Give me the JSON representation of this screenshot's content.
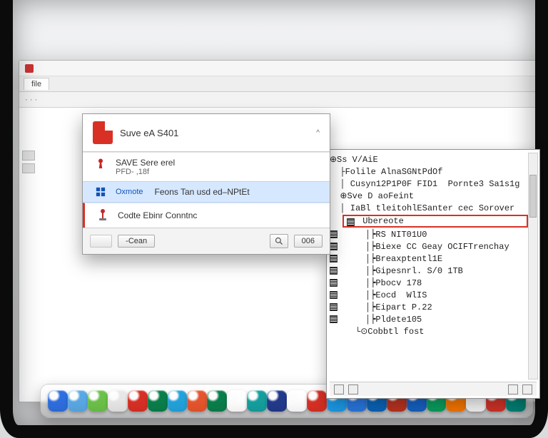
{
  "appwin": {
    "tab1": "file",
    "toolbar_hint": "· · ·"
  },
  "save_dialog": {
    "title": "Suve eA S401",
    "caret": "^",
    "r1_label": "SAVE Sere erel",
    "r1_sub": "PFD- ,18f",
    "sel_prefix": "Oxmote",
    "sel_text": "Feons Tan usd ed–NPtEt",
    "r3_text": "Codte Ebinr Conntnc",
    "cancel": "-Cean",
    "ok": "006"
  },
  "tree": {
    "l0": "⊕Ss V/AiE",
    "l1": "  ├Folile AlnaSGNtPdOf",
    "l2": "  │ Cusyn12P1P0F FID1  Pornte3 Sa1s1g",
    "l3": "  ⊕Sve D aoFeint",
    "l4": "  │ IaBl tleitohlESanter cec Sorover",
    "hl_text": "Ubereote",
    "l6": "     │┝RS NIT01U0",
    "l7": "     │┝Biexe CC Geay OCIFTrenchay",
    "l8": "     │┝Breaxptentl1E",
    "l9": "     │┝Gipesnrl. S/0 1TB",
    "l10": "     │┝Pbocv 178",
    "l11": "     │┝Eocd  WlIS",
    "l12": "     │┝Eipart P.22",
    "l13": "     │┝Pldete105",
    "l14": "     └⊙Cobbtl fost"
  },
  "dock_colors": [
    "#2f6fe0",
    "#5aa9e6",
    "#6cc24a",
    "#e8e8e8",
    "#d93025",
    "#0a7f4b",
    "#23a3dd",
    "#e8552d",
    "#0a7f4b",
    "#ffffff",
    "#15a0a0",
    "#233a8c",
    "#ffffff",
    "#d93025",
    "#1da1f2",
    "#2b7de9",
    "#0b68c1",
    "#c23522",
    "#1765cc",
    "#0aa562",
    "#ff7a00",
    "#ffffff",
    "#d8352a",
    "#00897b"
  ]
}
